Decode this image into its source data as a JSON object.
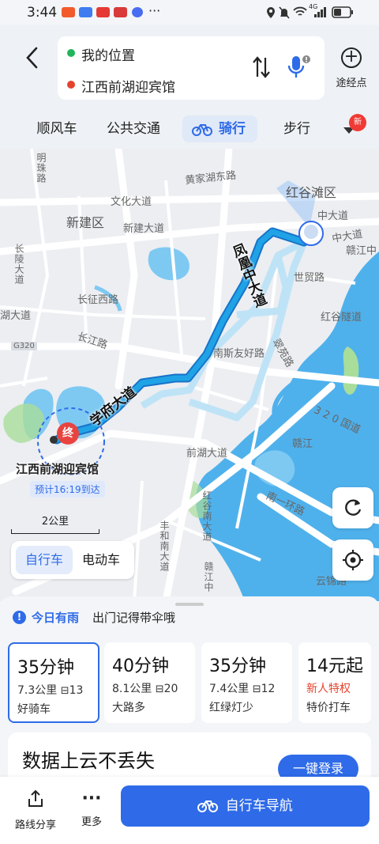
{
  "status_bar": {
    "time": "3:44",
    "more": "···",
    "network": "4G"
  },
  "header": {
    "start": "我的位置",
    "end": "江西前湖迎宾馆",
    "waypoint_label": "途经点"
  },
  "tabs": [
    {
      "label": "顺风车"
    },
    {
      "label": "公共交通"
    },
    {
      "label": "骑行",
      "active": true
    },
    {
      "label": "步行"
    }
  ],
  "tabs_badge": "新",
  "map": {
    "districts": [
      "红谷滩区",
      "新建区"
    ],
    "roads": [
      "黄家湖东路",
      "文化大道",
      "新建大道",
      "长征西路",
      "湖大道",
      "长江路",
      "中大道",
      "中大道",
      "赣江中",
      "世贸路",
      "红谷隧道",
      "南斯友好路",
      "翠苑路",
      "3 2 0 国道",
      "前湖大道",
      "赣江",
      "南一环路",
      "云锦路",
      "G320"
    ],
    "vertical_roads": [
      "明珠路",
      "长陵大道",
      "红谷南大道",
      "丰和南大道",
      "赣江中"
    ],
    "route_roads": [
      "凤凰中大道",
      "学府大道"
    ],
    "end_marker": "终",
    "destination": "江西前湖迎宾馆",
    "eta": "预计16:19到达",
    "scale": "2公里",
    "vehicle_options": [
      {
        "label": "自行车",
        "selected": true
      },
      {
        "label": "电动车"
      }
    ]
  },
  "weather": {
    "highlight": "今日有雨",
    "message": "出门记得带伞哦"
  },
  "routes": [
    {
      "time": "35分钟",
      "distance": "7.3公里",
      "lights": "13",
      "tag": "好骑车",
      "selected": true
    },
    {
      "time": "40分钟",
      "distance": "8.1公里",
      "lights": "20",
      "tag": "大路多"
    },
    {
      "time": "35分钟",
      "distance": "7.4公里",
      "lights": "12",
      "tag": "红绿灯少"
    },
    {
      "time": "14元起",
      "promo": "新人特权",
      "tag": "特价打车"
    }
  ],
  "promo": {
    "title": "数据上云不丢失",
    "button": "一键登录"
  },
  "bottom": {
    "share": "路线分享",
    "more": "更多",
    "navigate": "自行车导航"
  },
  "colors": {
    "accent": "#2f6be8",
    "route": "#1fa3e6",
    "water": "#4fb1ec",
    "green": "#a9dd9a"
  }
}
